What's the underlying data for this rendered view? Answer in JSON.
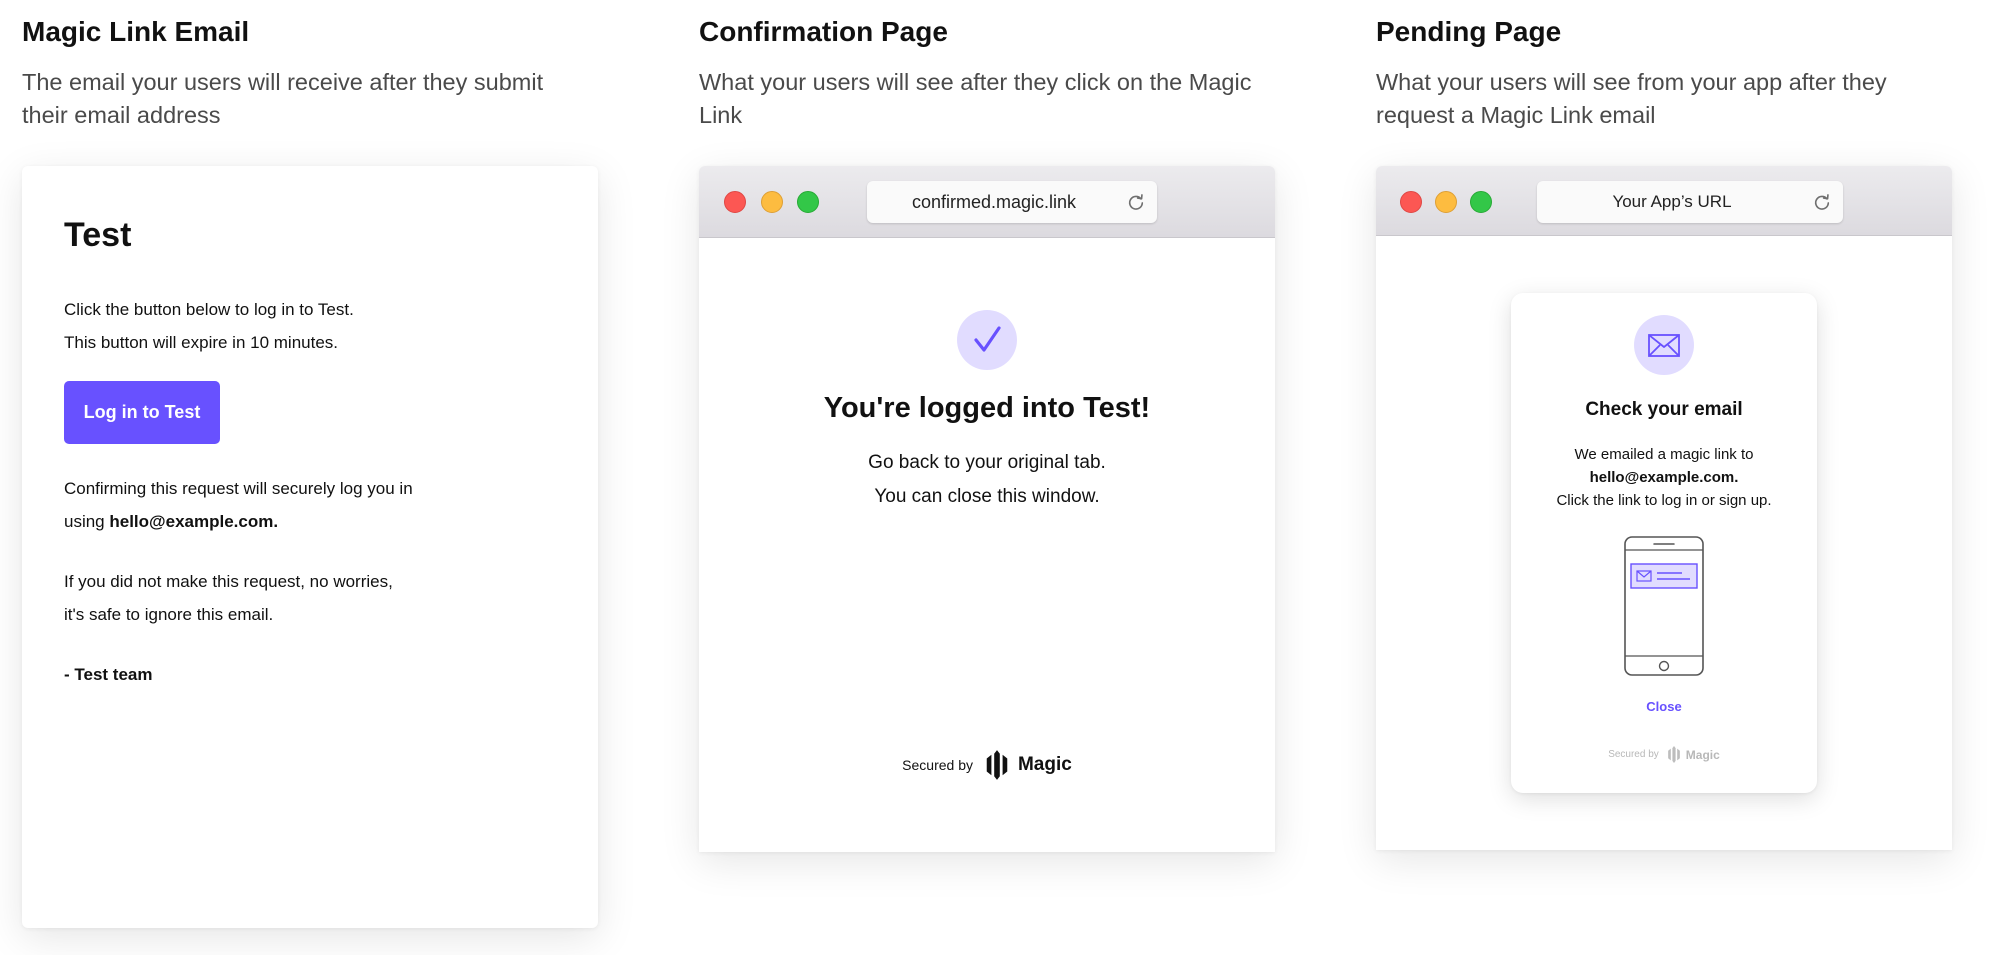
{
  "columns": {
    "email": {
      "title": "Magic Link Email",
      "description": "The email your users will receive after they submit their email address"
    },
    "confirmation": {
      "title": "Confirmation Page",
      "description": "What your users will see after they click on the Magic Link"
    },
    "pending": {
      "title": "Pending Page",
      "description": "What your users will see from your app after they request a Magic Link email"
    }
  },
  "email": {
    "heading": "Test",
    "line1": "Click the button below to log in to Test.",
    "line2": "This button will expire in 10 minutes.",
    "button_label": "Log in to Test",
    "confirm_line1": "Confirming this request will securely log you in",
    "confirm_line2_prefix": "using ",
    "confirm_line2_email": "hello@example.com.",
    "ignore_line1": "If you did not make this request, no worries,",
    "ignore_line2": "it's safe to ignore this email.",
    "signature": "- Test team"
  },
  "confirmation_page": {
    "url": "confirmed.magic.link",
    "title": "You're logged into Test!",
    "line1": "Go back to your original tab.",
    "line2": "You can close this window.",
    "secured_label": "Secured by",
    "brand": "Magic"
  },
  "pending_page": {
    "url": "Your App’s URL",
    "modal_title": "Check your email",
    "line1": "We emailed a magic link to",
    "email": "hello@example.com.",
    "line3": "Click the link to log in or sign up.",
    "close_label": "Close",
    "secured_label": "Secured by",
    "brand": "Magic"
  },
  "colors": {
    "accent": "#6851ff",
    "accent_light": "#e1dcff",
    "close_red": "#fc5753",
    "minimize_yellow": "#fdbc40",
    "maximize_green": "#33c748"
  },
  "icons": [
    "check-icon",
    "envelope-icon",
    "reload-icon",
    "magic-logo-icon",
    "phone-illustration"
  ]
}
